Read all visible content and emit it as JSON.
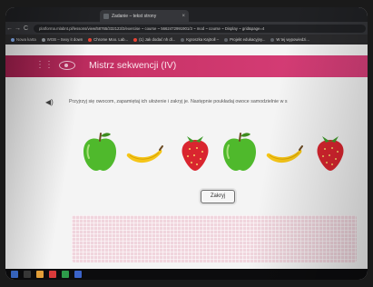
{
  "browser": {
    "tab_title": "Zadanie – tekst strony",
    "url": "platforma.mlabnt.pl/lessons/view/58765/332123/2/exercise ~ course ~ 5662472991901/3 ~ mod ~ course ~ Display ~ grid&page=4",
    "bookmarks": [
      {
        "label": "Nowa karta",
        "color": "#8ab4f8"
      },
      {
        "label": "WGB – Sexy it down",
        "color": "#9aa0a6"
      },
      {
        "label": "Chrome Moo. Lab...",
        "color": "#ea4335"
      },
      {
        "label": "(1) Jak dodać nh dl...",
        "color": "#ea4335"
      },
      {
        "label": "Kgroszka Kajtroll –",
        "color": "#5f6368"
      },
      {
        "label": "Projekt edukacyjny...",
        "color": "#5f6368"
      },
      {
        "label": "W tej wypowiedzi...",
        "color": "#5f6368"
      }
    ]
  },
  "site": {
    "title": "Mistrz sekwencji (IV)"
  },
  "instruction": "Przyjrzyj się owocom, zapamiętaj ich ułożenie i zakryj je. Następnie poukładaj owoce samodzielnie w s",
  "fruits": [
    "apple-icon",
    "banana-icon",
    "strawberry-icon",
    "apple-icon",
    "banana-icon",
    "strawberry-icon"
  ],
  "close_button": "Zakryj",
  "colors": {
    "header": "#c93367",
    "dropzone": "#f0d5dd"
  }
}
